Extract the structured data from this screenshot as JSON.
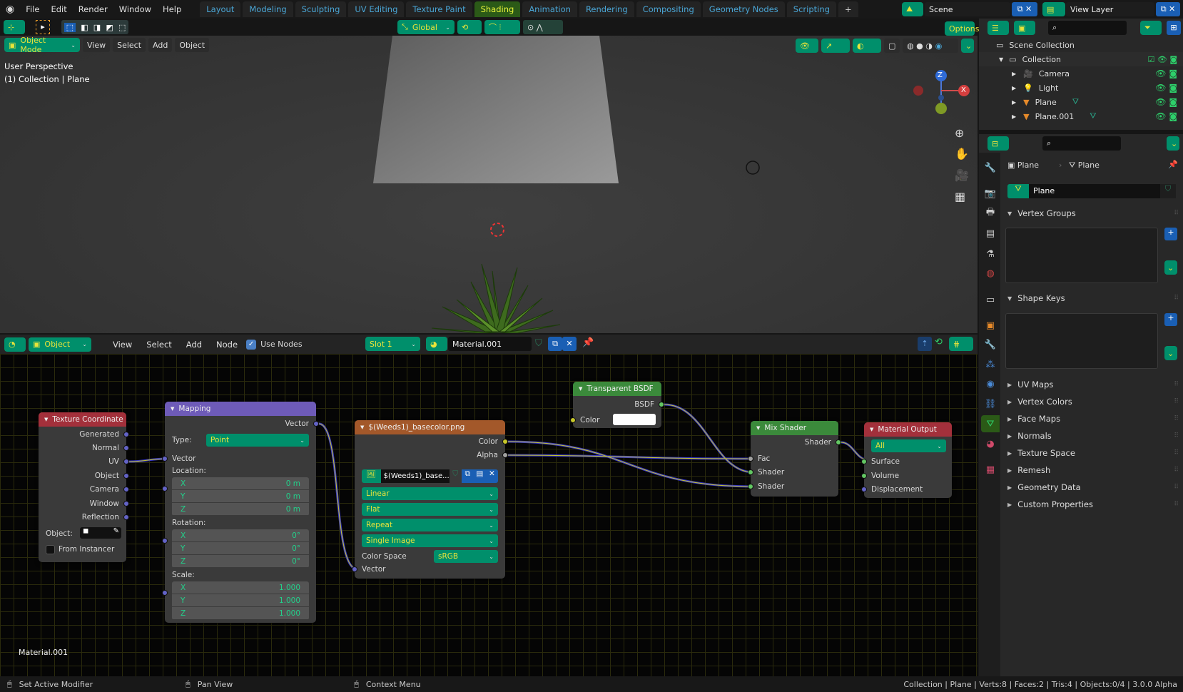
{
  "topbar": {
    "menus": [
      "File",
      "Edit",
      "Render",
      "Window",
      "Help"
    ],
    "workspaces": [
      "Layout",
      "Modeling",
      "Sculpting",
      "UV Editing",
      "Texture Paint",
      "Shading",
      "Animation",
      "Rendering",
      "Compositing",
      "Geometry Nodes",
      "Scripting"
    ],
    "active_workspace": "Shading",
    "add_tab": "+",
    "scene": "Scene",
    "view_layer": "View Layer"
  },
  "viewport": {
    "orientation": "Global",
    "options": "Options",
    "mode": "Object Mode",
    "menus": [
      "View",
      "Select",
      "Add",
      "Object"
    ],
    "overlay_title": "User Perspective",
    "overlay_subtitle": "(1) Collection | Plane",
    "gizmo": {
      "z": "Z",
      "x": "X"
    }
  },
  "node_editor": {
    "object_type": "Object",
    "menus": [
      "View",
      "Select",
      "Add",
      "Node"
    ],
    "use_nodes": "Use Nodes",
    "use_nodes_checked": true,
    "slot": "Slot 1",
    "material": "Material.001",
    "material_label": "Material.001",
    "nodes": {
      "texcoord": {
        "title": "Texture Coordinate",
        "outputs": [
          "Generated",
          "Normal",
          "UV",
          "Object",
          "Camera",
          "Window",
          "Reflection"
        ],
        "object_label": "Object:",
        "from_instancer": "From Instancer",
        "color": "#a3303b"
      },
      "mapping": {
        "title": "Mapping",
        "output": "Vector",
        "type_label": "Type:",
        "type": "Point",
        "input": "Vector",
        "location_label": "Location:",
        "location": [
          [
            "X",
            "0 m"
          ],
          [
            "Y",
            "0 m"
          ],
          [
            "Z",
            "0 m"
          ]
        ],
        "rotation_label": "Rotation:",
        "rotation": [
          [
            "X",
            "0°"
          ],
          [
            "Y",
            "0°"
          ],
          [
            "Z",
            "0°"
          ]
        ],
        "scale_label": "Scale:",
        "scale": [
          [
            "X",
            "1.000"
          ],
          [
            "Y",
            "1.000"
          ],
          [
            "Z",
            "1.000"
          ]
        ],
        "color": "#6e5bb8"
      },
      "image": {
        "title": "$(Weeds1)_basecolor.png",
        "outputs": [
          "Color",
          "Alpha"
        ],
        "image_name": "$(Weeds1)_base...",
        "interpolation": "Linear",
        "projection": "Flat",
        "extension": "Repeat",
        "source": "Single Image",
        "color_space_label": "Color Space",
        "color_space": "sRGB",
        "input": "Vector",
        "color": "#a3582a"
      },
      "transparent": {
        "title": "Transparent BSDF",
        "output": "BSDF",
        "input": "Color",
        "color": "#3b8a3b"
      },
      "mix": {
        "title": "Mix Shader",
        "output": "Shader",
        "inputs": [
          "Fac",
          "Shader",
          "Shader"
        ],
        "color": "#3b8a3b"
      },
      "output": {
        "title": "Material Output",
        "target": "All",
        "inputs": [
          "Surface",
          "Volume",
          "Displacement"
        ],
        "color": "#a3303b"
      }
    }
  },
  "outliner": {
    "root": "Scene Collection",
    "collection": "Collection",
    "objects": [
      "Camera",
      "Light",
      "Plane",
      "Plane.001"
    ]
  },
  "properties": {
    "breadcrumb": [
      "Plane",
      "Plane"
    ],
    "mesh_name": "Plane",
    "sections": [
      "Vertex Groups",
      "Shape Keys",
      "UV Maps",
      "Vertex Colors",
      "Face Maps",
      "Normals",
      "Texture Space",
      "Remesh",
      "Geometry Data",
      "Custom Properties"
    ]
  },
  "status": {
    "left": "Set Active Modifier",
    "middle": "Pan View",
    "right": "Context Menu",
    "stats": "Collection | Plane | Verts:8 | Faces:2 | Tris:4 | Objects:0/4 | 3.0.0 Alpha"
  }
}
